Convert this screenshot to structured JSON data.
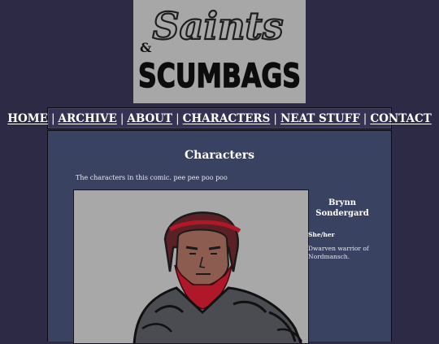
{
  "logo": {
    "line1": "Saints",
    "ampersand": "&",
    "line2": "SCUMBAGS"
  },
  "nav": {
    "items": [
      {
        "label": "HOME"
      },
      {
        "label": "ARCHIVE"
      },
      {
        "label": "ABOUT"
      },
      {
        "label": "CHARACTERS"
      },
      {
        "label": "NEAT STUFF"
      },
      {
        "label": "CONTACT"
      }
    ],
    "separator": "|"
  },
  "main": {
    "title": "Characters",
    "intro": "The characters in this comic. pee pee poo poo"
  },
  "character": {
    "name": "Brynn Sondergard",
    "pronouns": "She/her",
    "description": "Dwarven warrior of Nordmansch."
  },
  "colors": {
    "background": "#2d2a46",
    "panel": "#3a4262",
    "banner": "#a7a7a7",
    "beard": "#b0182a"
  }
}
